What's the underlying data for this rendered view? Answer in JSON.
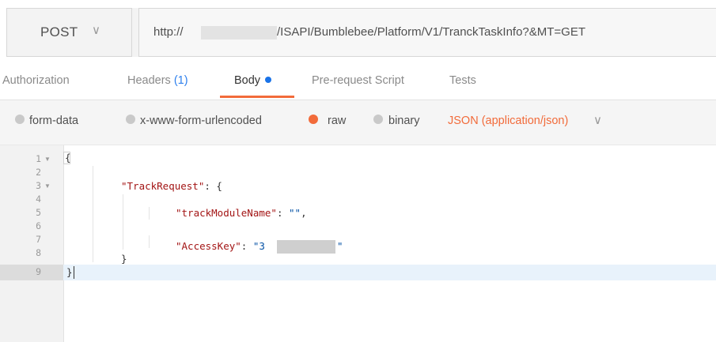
{
  "request": {
    "method": "POST",
    "url_prefix": "http://",
    "url_suffix": "/ISAPI/Bumblebee/Platform/V1/TranckTaskInfo?&MT=GET"
  },
  "tabs": [
    {
      "label": "Authorization"
    },
    {
      "label": "Headers",
      "count": "(1)"
    },
    {
      "label": "Body"
    },
    {
      "label": "Pre-request Script"
    },
    {
      "label": "Tests"
    }
  ],
  "body_modes": {
    "options": [
      "form-data",
      "x-www-form-urlencoded",
      "raw",
      "binary"
    ],
    "selected": "raw",
    "content_type": "JSON (application/json)"
  },
  "editor": {
    "line_numbers": [
      "1",
      "2",
      "3",
      "4",
      "5",
      "6",
      "7",
      "8",
      "9"
    ],
    "lines": {
      "l1": "{",
      "l3_key": "\"TrackRequest\"",
      "l3_rest": ": {",
      "l5_key": "\"trackModuleName\"",
      "l5_sep": ": ",
      "l5_val": "\"\"",
      "l5_end": ",",
      "l7_key": "\"AccessKey\"",
      "l7_sep": ": ",
      "l7_val_start": "\"3",
      "l7_val_end": "\"",
      "l8": "}",
      "l9": "}"
    }
  },
  "colors": {
    "accent": "#f26b3a",
    "headers_count": "#2f80ed",
    "body_dot": "#1a73e8",
    "json_key": "#a31515",
    "json_string": "#0451a5"
  },
  "icons": {
    "method_dropdown": "chevron-down-icon",
    "content_type_dropdown": "chevron-down-icon",
    "fold_markers": "fold-arrow-icon"
  }
}
